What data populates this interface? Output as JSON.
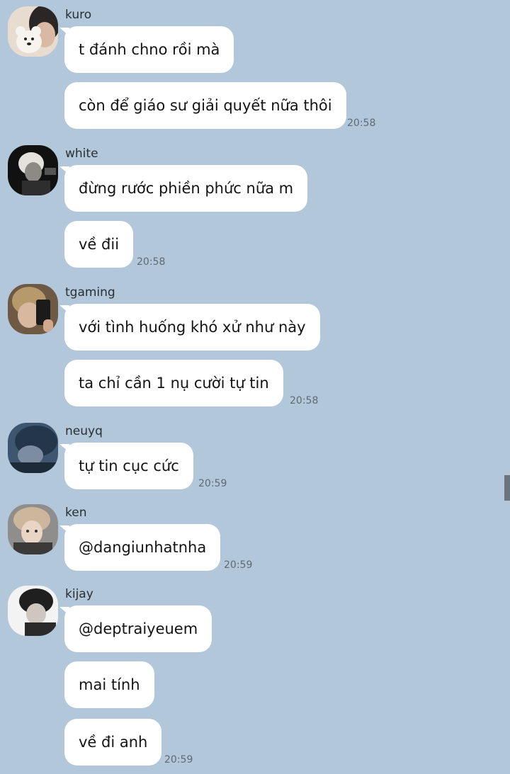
{
  "messages": [
    {
      "sender": "kuro",
      "avatar": "kuro-avatar",
      "texts": [
        "t đánh chno rồi mà",
        "còn để giáo sư giải quyết nữa thôi"
      ],
      "time": "20:58"
    },
    {
      "sender": "white",
      "avatar": "white-avatar",
      "texts": [
        "đừng rước phiền phức nữa m",
        "về đii"
      ],
      "time": "20:58"
    },
    {
      "sender": "tgaming",
      "avatar": "tgaming-avatar",
      "texts": [
        "với tình huống khó xử như này",
        "ta chỉ cần 1 nụ cười tự tin"
      ],
      "time": "20:58"
    },
    {
      "sender": "neuyq",
      "avatar": "neuyq-avatar",
      "texts": [
        "tự tin cục cức"
      ],
      "time": "20:59"
    },
    {
      "sender": "ken",
      "avatar": "ken-avatar",
      "texts": [
        "@dangiunhatnha"
      ],
      "time": "20:59"
    },
    {
      "sender": "kijay",
      "avatar": "kijay-avatar",
      "texts": [
        "@deptraiyeuem",
        "mai tính",
        "về đi anh"
      ],
      "time": "20:59"
    }
  ],
  "colors": {
    "background": "#b2c7d9",
    "bubble": "#ffffff",
    "timestamp": "#5f6b75"
  }
}
